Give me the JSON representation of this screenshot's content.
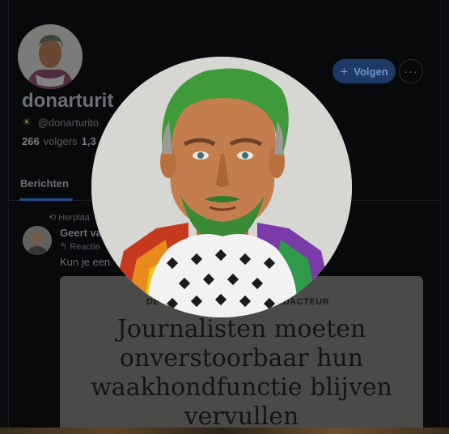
{
  "profile": {
    "display_name": "donarturit",
    "handle": "@donarturito",
    "followers_count": "266",
    "followers_label": "volgers",
    "following_partial": "1,3",
    "follow_label": "Volgen",
    "more_label": "···"
  },
  "tabs": {
    "posts": "Berichten"
  },
  "post": {
    "repost_label": "Herplaa",
    "author": "Geert va",
    "reply_label": "Reactie",
    "text": "Kun je een"
  },
  "card": {
    "kicker_left": "DE",
    "kicker_right": "EDACTEUR",
    "headline": "Journalisten moeten onverstoorbaar hun waakhondfunctie blijven vervullen"
  },
  "icons": {
    "follow": "plus-icon",
    "repost": "repost-icon",
    "reply": "reply-icon",
    "handle_badge": "sun-icon"
  },
  "colors": {
    "accent": "#1d3a66",
    "background": "#08090b"
  }
}
